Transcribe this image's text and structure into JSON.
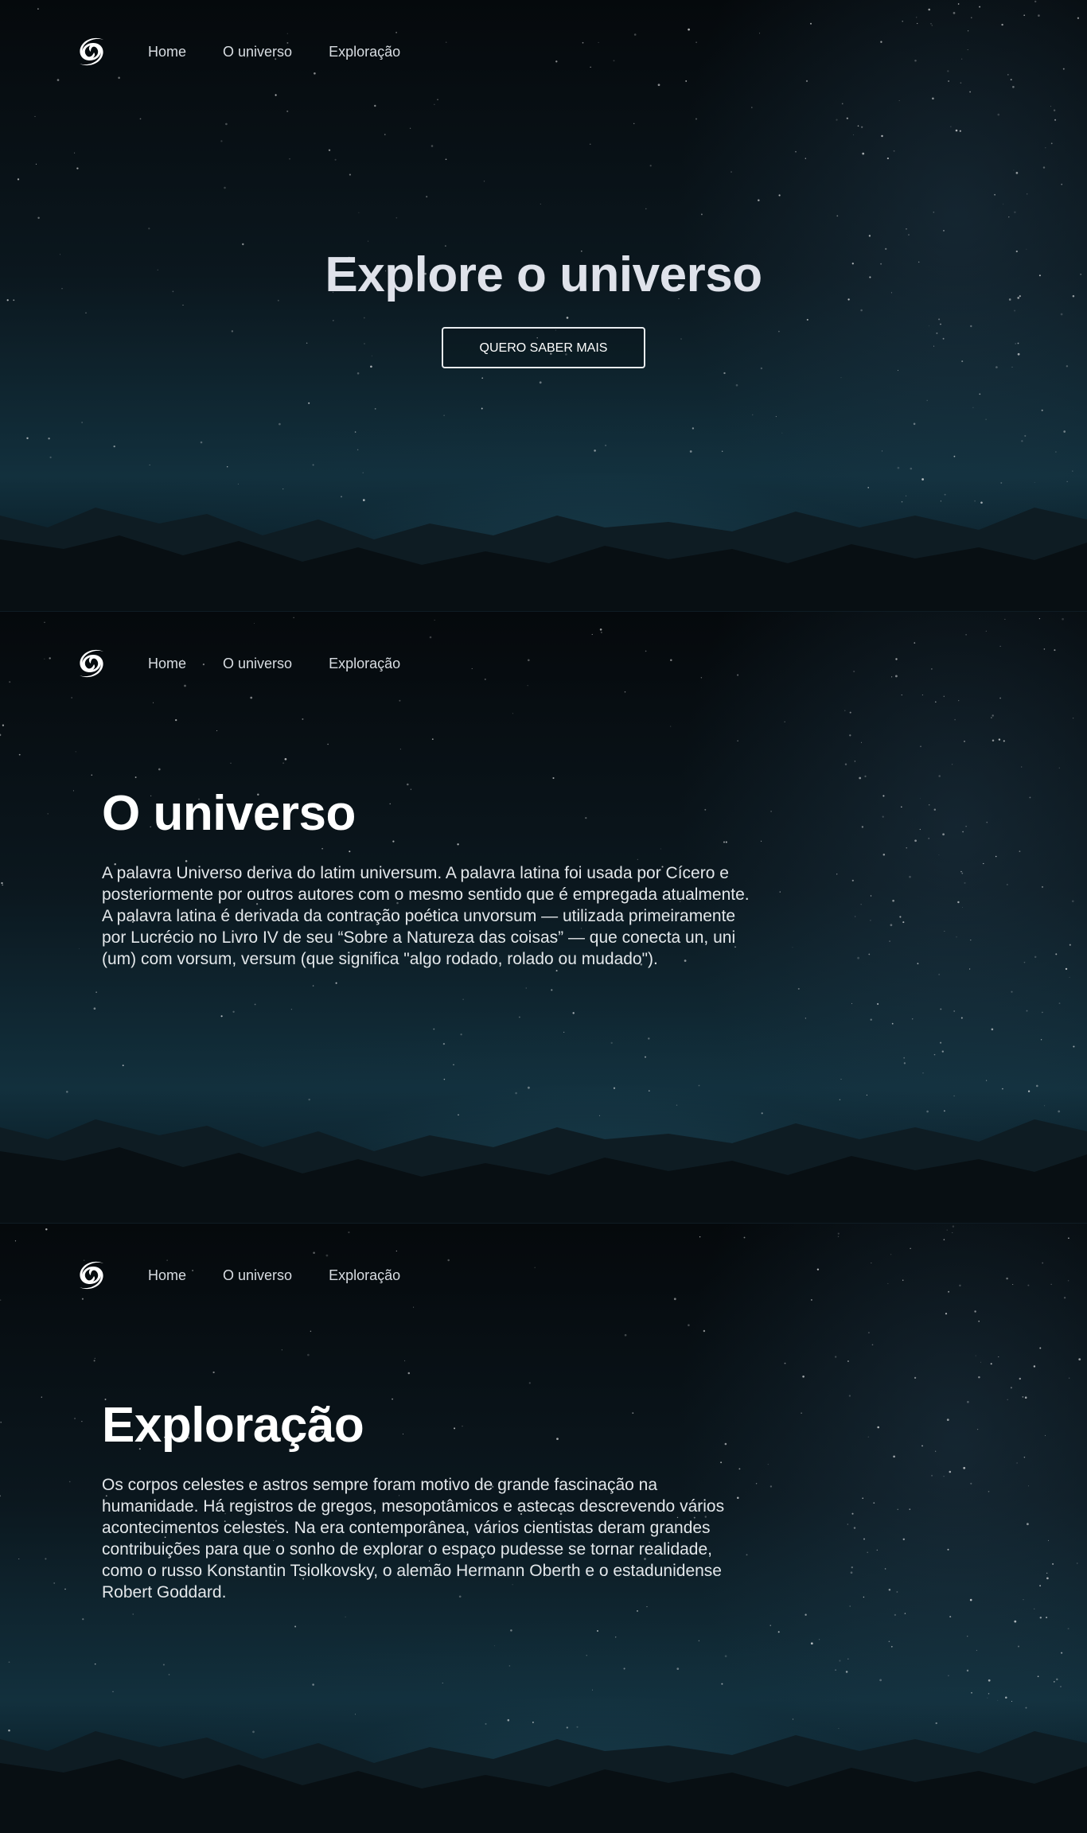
{
  "nav": {
    "logo_icon": "spiral-galaxy-icon",
    "items": [
      {
        "label": "Home"
      },
      {
        "label": "O universo"
      },
      {
        "label": "Exploração"
      }
    ]
  },
  "hero": {
    "title": "Explore o universo",
    "button_label": "QUERO SABER MAIS"
  },
  "universe": {
    "title": "O universo",
    "text": "A palavra Universo deriva do latim universum. A palavra latina foi usada por Cícero e posteriormente por outros autores com o mesmo sentido que é empregada atualmente. A palavra latina é derivada da contração poética unvorsum — utilizada primeiramente por Lucrécio no Livro IV de seu “Sobre a Natureza das coisas” — que conecta un, uni (um) com vorsum, versum (que significa \"algo rodado, rolado ou mudado\")."
  },
  "exploration": {
    "title": "Exploração",
    "text": "Os corpos celestes e astros sempre foram motivo de grande fascinação na humanidade. Há registros de gregos, mesopotâmicos e astecas descrevendo vários acontecimentos celestes. Na era contemporânea, vários cientistas deram grandes contribuições para que o sonho de explorar o espaço pudesse se tornar realidade, como o russo Konstantin Tsiolkovsky, o alemão Hermann Oberth e o estadunidense Robert Goddard."
  },
  "colors": {
    "background": "#0b171e",
    "horizon_glow": "#12303d",
    "text": "#ffffff"
  }
}
